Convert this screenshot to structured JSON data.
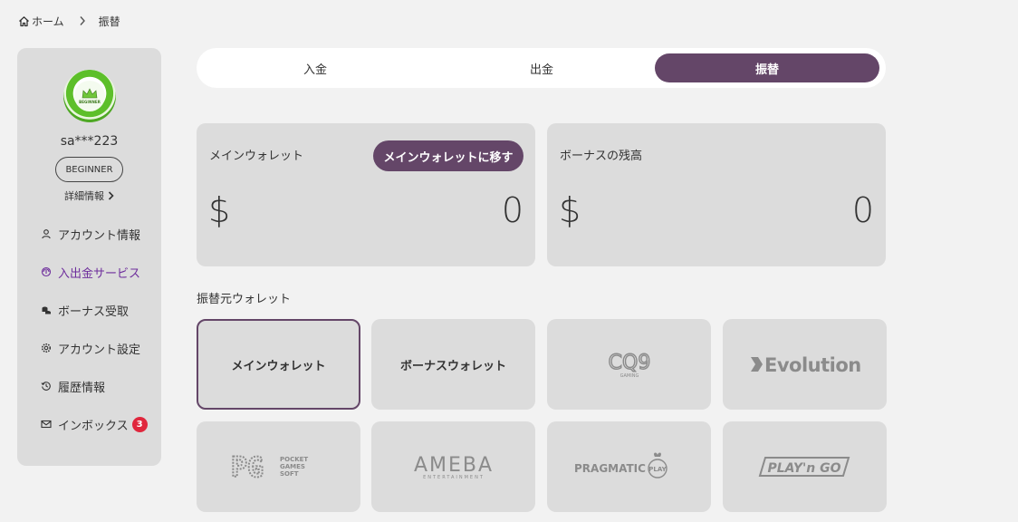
{
  "breadcrumb": {
    "home": "ホーム",
    "current": "振替"
  },
  "profile": {
    "username": "sa***223",
    "rank": "BEGINNER",
    "details": "詳細情報",
    "avatar_text": "BEGINNER"
  },
  "menu": {
    "items": [
      {
        "label": "アカウント情報",
        "icon": "user-icon"
      },
      {
        "label": "入出金サービス",
        "icon": "deposit-icon"
      },
      {
        "label": "ボーナス受取",
        "icon": "coins-icon"
      },
      {
        "label": "アカウント設定",
        "icon": "gear-icon"
      },
      {
        "label": "履歴情報",
        "icon": "history-icon"
      },
      {
        "label": "インボックス",
        "icon": "mail-icon",
        "badge": "3"
      }
    ]
  },
  "tabs": [
    {
      "label": "入金"
    },
    {
      "label": "出金"
    },
    {
      "label": "振替"
    }
  ],
  "wallets": {
    "main": {
      "title": "メインウォレット",
      "currency": "$",
      "amount": "0",
      "button": "メインウォレットに移す"
    },
    "bonus": {
      "title": "ボーナスの残高",
      "currency": "$",
      "amount": "0"
    }
  },
  "source_section": {
    "title": "振替元ウォレット",
    "items": [
      {
        "label": "メインウォレット"
      },
      {
        "label": "ボーナスウォレット"
      },
      {
        "logo": "CQ9",
        "sub": "GAMING"
      },
      {
        "logo": "Evolution"
      },
      {
        "logo": "PG",
        "sub": "POCKET GAMES SOFT"
      },
      {
        "logo": "AMEBA",
        "sub": "ENTERTAINMENT"
      },
      {
        "logo": "PRAGMATIC",
        "sub": "PLAY"
      },
      {
        "logo": "PLAY'n GO"
      }
    ]
  },
  "colors": {
    "accent": "#644668",
    "active_menu": "#6e2e9c",
    "badge": "#e0273d",
    "card": "#dcdcdc",
    "background": "#f2f2f2"
  }
}
